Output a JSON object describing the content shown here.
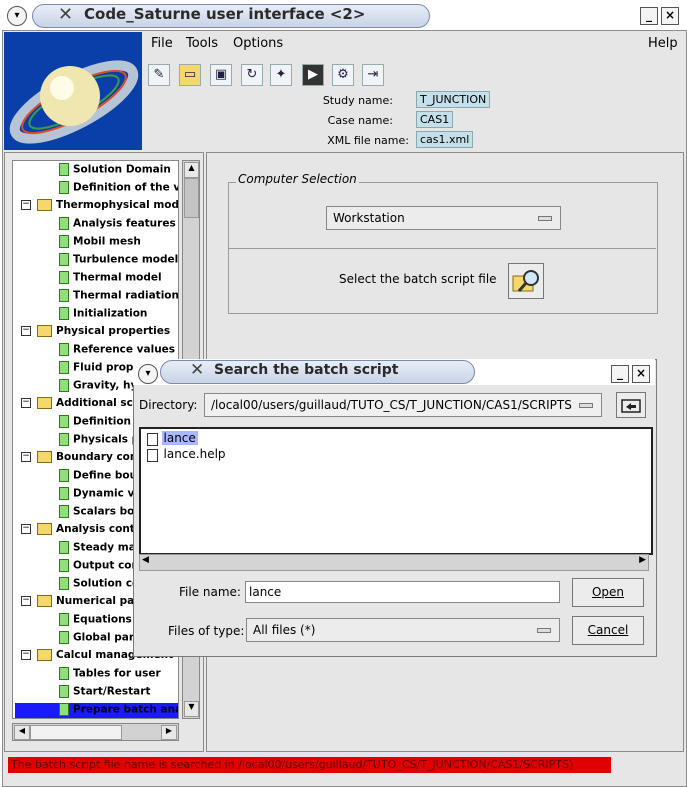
{
  "window": {
    "title": "Code_Saturne user interface <2>"
  },
  "menu": {
    "file": "File",
    "tools": "Tools",
    "options": "Options",
    "help": "Help"
  },
  "toolbar": {
    "icons": [
      "new-file-icon",
      "open-xml-icon",
      "save-icon",
      "refresh-icon",
      "tools-icon",
      "terminal-icon",
      "run-icon",
      "exit-icon"
    ]
  },
  "study": {
    "study_label": "Study name:",
    "study_value": "T_JUNCTION",
    "case_label": "Case name:",
    "case_value": "CAS1",
    "xml_label": "XML file name:",
    "xml_value": "cas1.xml"
  },
  "tree": {
    "rows": [
      {
        "label": "Solution Domain",
        "kind": "leaf"
      },
      {
        "label": "Definition of the volu",
        "kind": "leaf"
      },
      {
        "label": "Thermophysical models",
        "kind": "folder"
      },
      {
        "label": "Analysis features",
        "kind": "leaf"
      },
      {
        "label": "Mobil mesh",
        "kind": "leaf"
      },
      {
        "label": "Turbulence models",
        "kind": "leaf"
      },
      {
        "label": "Thermal model",
        "kind": "leaf"
      },
      {
        "label": "Thermal radiation",
        "kind": "leaf"
      },
      {
        "label": "Initialization",
        "kind": "leaf"
      },
      {
        "label": "Physical properties",
        "kind": "folder"
      },
      {
        "label": "Reference values",
        "kind": "leaf"
      },
      {
        "label": "Fluid proper",
        "kind": "leaf"
      },
      {
        "label": "Gravity, hyd",
        "kind": "leaf"
      },
      {
        "label": "Additional scal",
        "kind": "folder"
      },
      {
        "label": "Definition a",
        "kind": "leaf"
      },
      {
        "label": "Physicals p",
        "kind": "leaf"
      },
      {
        "label": "Boundary cond",
        "kind": "folder"
      },
      {
        "label": "Define boun",
        "kind": "leaf"
      },
      {
        "label": "Dynamic va",
        "kind": "leaf"
      },
      {
        "label": "Scalars bou",
        "kind": "leaf"
      },
      {
        "label": "Analysis contr",
        "kind": "folder"
      },
      {
        "label": "Steady man",
        "kind": "leaf"
      },
      {
        "label": "Output cont",
        "kind": "leaf"
      },
      {
        "label": "Solution co",
        "kind": "leaf"
      },
      {
        "label": "Numerical para",
        "kind": "folder"
      },
      {
        "label": "Equations p",
        "kind": "leaf"
      },
      {
        "label": "Global para",
        "kind": "leaf"
      },
      {
        "label": "Calcul management",
        "kind": "folder"
      },
      {
        "label": "Tables for user",
        "kind": "leaf"
      },
      {
        "label": "Start/Restart",
        "kind": "leaf"
      },
      {
        "label": "Prepare batch analy",
        "kind": "leaf",
        "selected": true
      }
    ]
  },
  "computer": {
    "group_title": "Computer Selection",
    "workstation": "Workstation",
    "batch_label": "Select the batch script file"
  },
  "dialog": {
    "title": "Search the batch script",
    "directory_label": "Directory:",
    "directory_value": "/local00/users/guillaud/TUTO_CS/T_JUNCTION/CAS1/SCRIPTS",
    "files": [
      "lance",
      "lance.help"
    ],
    "filename_label": "File name:",
    "filename_value": "lance",
    "filetype_label": "Files of type:",
    "filetype_value": "All files (*)",
    "open_label": "Open",
    "cancel_label": "Cancel"
  },
  "status": {
    "message": "The batch script file name is searched in /local00/users/guillaud/TUTO_CS/T_JUNCTION/CAS1/SCRIPTS)"
  },
  "colors": {
    "status_bg": "#e00000",
    "info_bg": "#c5e0ea",
    "selection": "#1a1aff",
    "logo_bg": "#0a3ea8"
  }
}
